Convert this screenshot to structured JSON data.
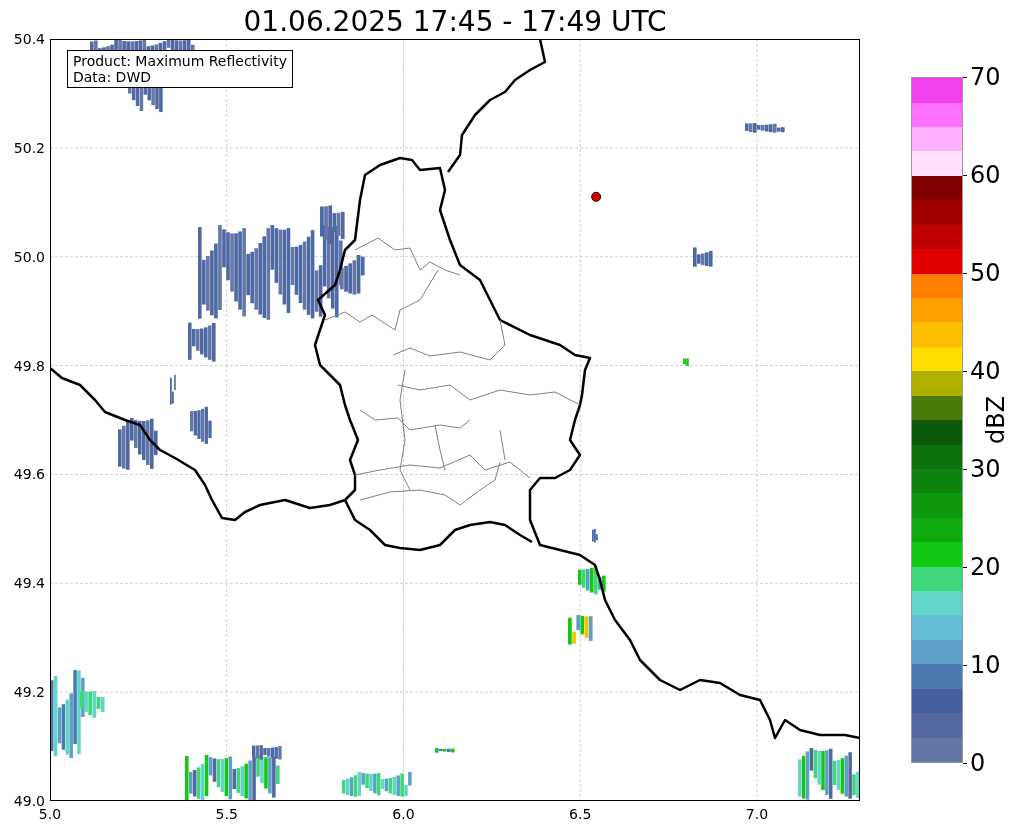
{
  "title": "01.06.2025 17:45 - 17:49 UTC",
  "legend": [
    "Product: Maximum Reflectivity",
    "Data: DWD"
  ],
  "map": {
    "x_tick_labels": [
      "5.0",
      "5.5",
      "6.0",
      "6.5",
      "7.0"
    ],
    "y_tick_labels": [
      "50.4",
      "50.2",
      "50.0",
      "49.8",
      "49.6",
      "49.4",
      "49.2",
      "49.0"
    ]
  },
  "colorbar": {
    "label": "dBZ",
    "tick_labels": [
      "70",
      "60",
      "50",
      "40",
      "30",
      "20",
      "10",
      "0"
    ],
    "bins": [
      {
        "color": "#6577a6"
      },
      {
        "color": "#5468a0"
      },
      {
        "color": "#44609e"
      },
      {
        "color": "#4a7ab0"
      },
      {
        "color": "#5ca0c8"
      },
      {
        "color": "#64bcd6"
      },
      {
        "color": "#62d6c6"
      },
      {
        "color": "#40d67a"
      },
      {
        "color": "#12c812"
      },
      {
        "color": "#10aa10"
      },
      {
        "color": "#0e980e"
      },
      {
        "color": "#0e840e"
      },
      {
        "color": "#0c700c"
      },
      {
        "color": "#0a5a0a"
      },
      {
        "color": "#4a7a0a"
      },
      {
        "color": "#b0b000"
      },
      {
        "color": "#ffdc00"
      },
      {
        "color": "#ffbe00"
      },
      {
        "color": "#ffa000"
      },
      {
        "color": "#ff8000"
      },
      {
        "color": "#e00000"
      },
      {
        "color": "#c00000"
      },
      {
        "color": "#a00000"
      },
      {
        "color": "#800000"
      },
      {
        "color": "#ffe0ff"
      },
      {
        "color": "#ffb0ff"
      },
      {
        "color": "#ff70ff"
      },
      {
        "color": "#f040f0"
      }
    ]
  }
}
